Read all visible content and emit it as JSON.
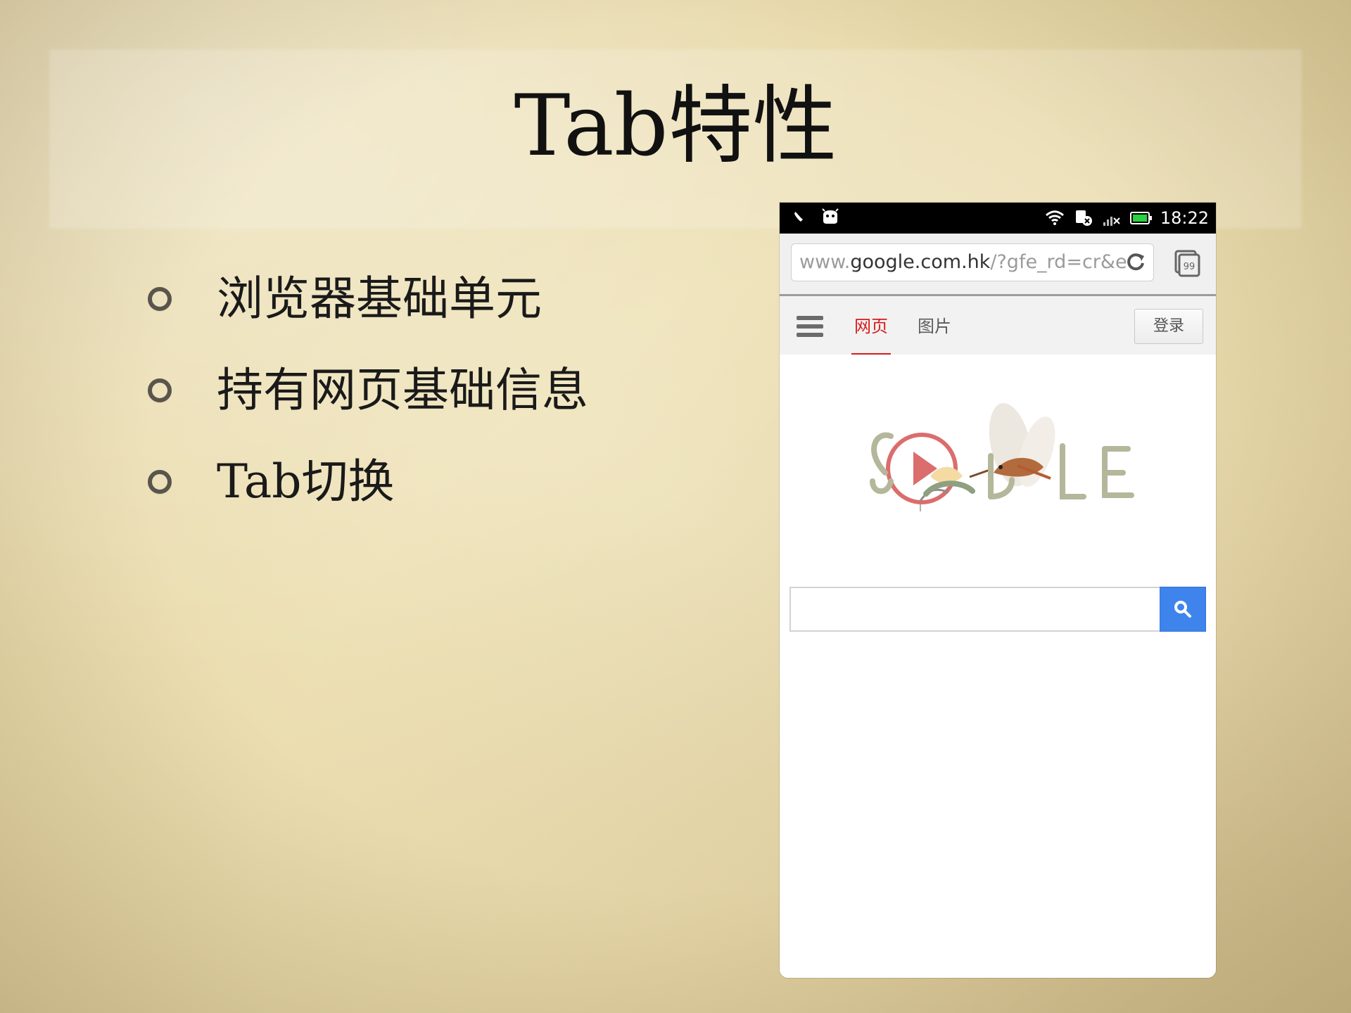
{
  "slide": {
    "title": "Tab特性",
    "bullets": [
      "浏览器基础单元",
      "持有网页基础信息",
      "Tab切换"
    ]
  },
  "phone": {
    "status_bar": {
      "time": "18:22",
      "icons": [
        "notification-icon",
        "android-icon",
        "wifi-icon",
        "data-off-icon",
        "signal-icon",
        "battery-icon"
      ]
    },
    "browser": {
      "url_domain_prefix": "www.",
      "url_domain": "google.com.hk",
      "url_rest": "/?gfe_rd=cr&e",
      "tabs_count": "99"
    },
    "google": {
      "tabs": [
        {
          "label": "网页",
          "active": true
        },
        {
          "label": "图片",
          "active": false
        }
      ],
      "login_label": "登录",
      "doodle_letters": "GOOGLE",
      "search_placeholder": ""
    }
  },
  "colors": {
    "accent_red": "#d81b1b",
    "search_blue": "#3f84ed"
  }
}
